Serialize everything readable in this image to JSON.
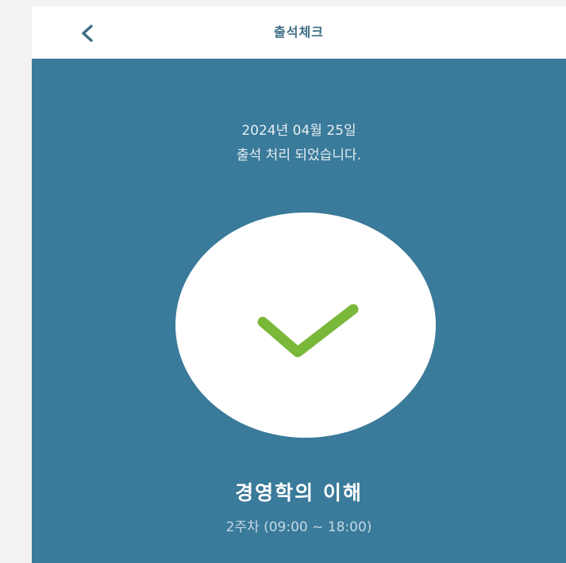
{
  "header": {
    "title": "출석체크",
    "back_icon": "chevron-left-icon"
  },
  "attendance": {
    "date": "2024년 04월 25일",
    "message": "출석 처리 되었습니다.",
    "status_icon": "check-icon",
    "course_name": "경영학의 이해",
    "session": "2주차 (09:00 ~ 18:00)"
  },
  "colors": {
    "panel": "#3a7a9a",
    "accent": "#3d6d84",
    "check": "#7ab83a",
    "circle": "#ffffff"
  }
}
